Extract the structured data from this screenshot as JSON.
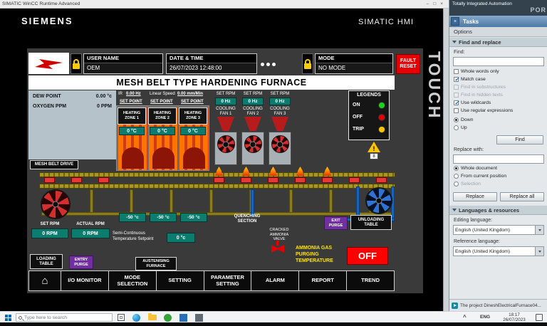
{
  "window": {
    "title": "SIMATIC WinCC Runtime Advanced",
    "minimize": "–",
    "maximize": "□",
    "close": "×"
  },
  "hmi": {
    "brand": "SIEMENS",
    "product": "SIMATIC HMI",
    "touch": "TOUCH",
    "icons": {
      "home": "⌂",
      "warning": "!"
    },
    "header": {
      "user_label": "USER NAME",
      "user_value": "OEM",
      "datetime_label": "DATE & TIME",
      "datetime_value": "26/07/2023 12:48:00",
      "mode_label": "MODE",
      "mode_value": "NO MODE",
      "fault_reset": "FAULT RESET"
    },
    "title": "MESH BELT TYPE HARDENING FURNACE",
    "gas_panel": {
      "rows": [
        {
          "label": "DEW POINT",
          "value": "0.00 °c"
        },
        {
          "label": "OXYGEN PPM",
          "value": "0 PPM"
        }
      ]
    },
    "drive_info": {
      "ir_label": "IR",
      "ir_value": "0.00 Hz",
      "speed_label": "Linear Speed",
      "speed_value": "0.00 mm/Min",
      "set_point": "SET POINT"
    },
    "heating_zones": [
      {
        "name": "HEATING ZONE 1",
        "temp": "0 °C"
      },
      {
        "name": "HEATING ZONE 2",
        "temp": "0 °C"
      },
      {
        "name": "HEATING ZONE 3",
        "temp": "0 °C"
      }
    ],
    "cooling_fans": [
      {
        "set_rpm": "SET RPM",
        "hz": "0 Hz",
        "name": "COOLING FAN 1"
      },
      {
        "set_rpm": "SET RPM",
        "hz": "0 Hz",
        "name": "COOLING FAN 2"
      },
      {
        "set_rpm": "SET RPM",
        "hz": "0 Hz",
        "name": "COOLING FAN 3"
      }
    ],
    "legends": {
      "title": "LEGENDS",
      "items": [
        {
          "label": "ON",
          "color": "#1dd11d"
        },
        {
          "label": "OFF",
          "color": "#e60000"
        },
        {
          "label": "TRIP",
          "color": "#ffc400"
        }
      ]
    },
    "alarm_count": "8",
    "mesh_belt_drive": "MESH BELT DRIVE",
    "zone_temps": [
      "-50 °c",
      "-50 °c",
      "-50 °c"
    ],
    "quenching": "QUENCHING SECTION",
    "rpm": {
      "set_label": "SET RPM",
      "actual_label": "ACTUAL RPM",
      "set_value": "0 RPM",
      "actual_value": "0 RPM"
    },
    "semi": {
      "label": "Semi-Continuous Temperature Setpoint",
      "value": "0 °c"
    },
    "valve_label": "CRACKED AMMONIA VALVE",
    "buttons": {
      "exit_purge": "EXIT PURGE",
      "unloading_table": "UNLOADING TABLE",
      "loading_table": "LOADING TABLE",
      "entry_purge": "ENTRY PURGE",
      "austenising_furnace": "AUSTENISING FURNACE"
    },
    "ammonia_text": "AMMONIA GAS PURGING TEMPERATURE",
    "off_button": "OFF",
    "nav": [
      "I/O MONITOR",
      "MODE SELECTION",
      "SETTING",
      "PARAMETER SETTING",
      "ALARM",
      "REPORT",
      "TREND"
    ]
  },
  "tia": {
    "header_line1": "Totally Integrated Automation",
    "header_line2": "POR",
    "tasks_title": "Tasks",
    "close": "×",
    "options": "Options",
    "find_replace": {
      "section": "Find and replace",
      "find_label": "Find:",
      "find_value": "",
      "checkboxes": [
        {
          "label": "Whole words only",
          "checked": false,
          "disabled": false
        },
        {
          "label": "Match case",
          "checked": true,
          "disabled": false
        },
        {
          "label": "Find in substructures",
          "checked": false,
          "disabled": true
        },
        {
          "label": "Find in hidden texts",
          "checked": false,
          "disabled": true
        },
        {
          "label": "Use wildcards",
          "checked": true,
          "disabled": false
        },
        {
          "label": "Use regular expressions",
          "checked": false,
          "disabled": false
        }
      ],
      "direction": [
        {
          "label": "Down",
          "selected": true
        },
        {
          "label": "Up",
          "selected": false
        }
      ],
      "find_button": "Find",
      "replace_label": "Replace with:",
      "replace_value": "",
      "scope": [
        {
          "label": "Whole document",
          "selected": true
        },
        {
          "label": "From current position",
          "selected": false
        },
        {
          "label": "Selection",
          "selected": false
        }
      ],
      "replace_button": "Replace",
      "replace_all_button": "Replace all"
    },
    "languages": {
      "section": "Languages & resources",
      "editing_label": "Editing language:",
      "editing_value": "English (United Kingdom)",
      "reference_label": "Reference language:",
      "reference_value": "English (United Kingdom)"
    },
    "status": "The project DineshElectricalFurnace04..."
  },
  "taskbar": {
    "search_placeholder": "Type here to search",
    "tray_chevron": "^",
    "language": "ENG",
    "time": "18:17",
    "date": "26/07/2023"
  }
}
